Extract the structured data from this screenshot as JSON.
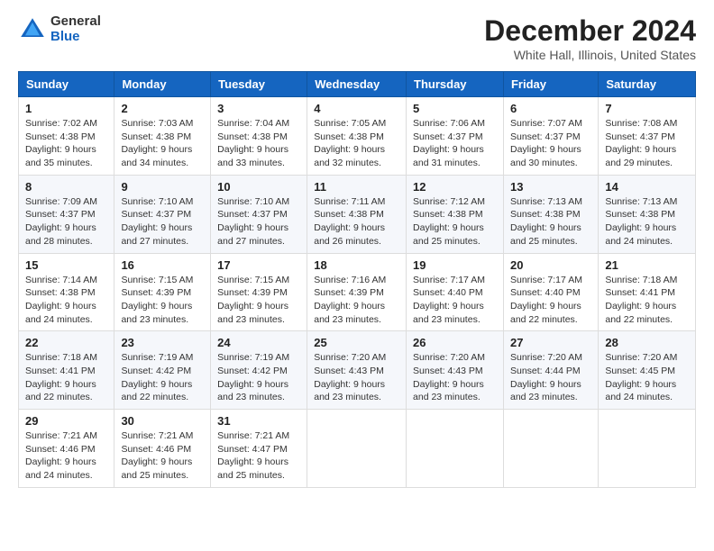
{
  "header": {
    "logo_general": "General",
    "logo_blue": "Blue",
    "title": "December 2024",
    "subtitle": "White Hall, Illinois, United States"
  },
  "days_of_week": [
    "Sunday",
    "Monday",
    "Tuesday",
    "Wednesday",
    "Thursday",
    "Friday",
    "Saturday"
  ],
  "weeks": [
    [
      {
        "day": "1",
        "info": "Sunrise: 7:02 AM\nSunset: 4:38 PM\nDaylight: 9 hours\nand 35 minutes."
      },
      {
        "day": "2",
        "info": "Sunrise: 7:03 AM\nSunset: 4:38 PM\nDaylight: 9 hours\nand 34 minutes."
      },
      {
        "day": "3",
        "info": "Sunrise: 7:04 AM\nSunset: 4:38 PM\nDaylight: 9 hours\nand 33 minutes."
      },
      {
        "day": "4",
        "info": "Sunrise: 7:05 AM\nSunset: 4:38 PM\nDaylight: 9 hours\nand 32 minutes."
      },
      {
        "day": "5",
        "info": "Sunrise: 7:06 AM\nSunset: 4:37 PM\nDaylight: 9 hours\nand 31 minutes."
      },
      {
        "day": "6",
        "info": "Sunrise: 7:07 AM\nSunset: 4:37 PM\nDaylight: 9 hours\nand 30 minutes."
      },
      {
        "day": "7",
        "info": "Sunrise: 7:08 AM\nSunset: 4:37 PM\nDaylight: 9 hours\nand 29 minutes."
      }
    ],
    [
      {
        "day": "8",
        "info": "Sunrise: 7:09 AM\nSunset: 4:37 PM\nDaylight: 9 hours\nand 28 minutes."
      },
      {
        "day": "9",
        "info": "Sunrise: 7:10 AM\nSunset: 4:37 PM\nDaylight: 9 hours\nand 27 minutes."
      },
      {
        "day": "10",
        "info": "Sunrise: 7:10 AM\nSunset: 4:37 PM\nDaylight: 9 hours\nand 27 minutes."
      },
      {
        "day": "11",
        "info": "Sunrise: 7:11 AM\nSunset: 4:38 PM\nDaylight: 9 hours\nand 26 minutes."
      },
      {
        "day": "12",
        "info": "Sunrise: 7:12 AM\nSunset: 4:38 PM\nDaylight: 9 hours\nand 25 minutes."
      },
      {
        "day": "13",
        "info": "Sunrise: 7:13 AM\nSunset: 4:38 PM\nDaylight: 9 hours\nand 25 minutes."
      },
      {
        "day": "14",
        "info": "Sunrise: 7:13 AM\nSunset: 4:38 PM\nDaylight: 9 hours\nand 24 minutes."
      }
    ],
    [
      {
        "day": "15",
        "info": "Sunrise: 7:14 AM\nSunset: 4:38 PM\nDaylight: 9 hours\nand 24 minutes."
      },
      {
        "day": "16",
        "info": "Sunrise: 7:15 AM\nSunset: 4:39 PM\nDaylight: 9 hours\nand 23 minutes."
      },
      {
        "day": "17",
        "info": "Sunrise: 7:15 AM\nSunset: 4:39 PM\nDaylight: 9 hours\nand 23 minutes."
      },
      {
        "day": "18",
        "info": "Sunrise: 7:16 AM\nSunset: 4:39 PM\nDaylight: 9 hours\nand 23 minutes."
      },
      {
        "day": "19",
        "info": "Sunrise: 7:17 AM\nSunset: 4:40 PM\nDaylight: 9 hours\nand 23 minutes."
      },
      {
        "day": "20",
        "info": "Sunrise: 7:17 AM\nSunset: 4:40 PM\nDaylight: 9 hours\nand 22 minutes."
      },
      {
        "day": "21",
        "info": "Sunrise: 7:18 AM\nSunset: 4:41 PM\nDaylight: 9 hours\nand 22 minutes."
      }
    ],
    [
      {
        "day": "22",
        "info": "Sunrise: 7:18 AM\nSunset: 4:41 PM\nDaylight: 9 hours\nand 22 minutes."
      },
      {
        "day": "23",
        "info": "Sunrise: 7:19 AM\nSunset: 4:42 PM\nDaylight: 9 hours\nand 22 minutes."
      },
      {
        "day": "24",
        "info": "Sunrise: 7:19 AM\nSunset: 4:42 PM\nDaylight: 9 hours\nand 23 minutes."
      },
      {
        "day": "25",
        "info": "Sunrise: 7:20 AM\nSunset: 4:43 PM\nDaylight: 9 hours\nand 23 minutes."
      },
      {
        "day": "26",
        "info": "Sunrise: 7:20 AM\nSunset: 4:43 PM\nDaylight: 9 hours\nand 23 minutes."
      },
      {
        "day": "27",
        "info": "Sunrise: 7:20 AM\nSunset: 4:44 PM\nDaylight: 9 hours\nand 23 minutes."
      },
      {
        "day": "28",
        "info": "Sunrise: 7:20 AM\nSunset: 4:45 PM\nDaylight: 9 hours\nand 24 minutes."
      }
    ],
    [
      {
        "day": "29",
        "info": "Sunrise: 7:21 AM\nSunset: 4:46 PM\nDaylight: 9 hours\nand 24 minutes."
      },
      {
        "day": "30",
        "info": "Sunrise: 7:21 AM\nSunset: 4:46 PM\nDaylight: 9 hours\nand 25 minutes."
      },
      {
        "day": "31",
        "info": "Sunrise: 7:21 AM\nSunset: 4:47 PM\nDaylight: 9 hours\nand 25 minutes."
      },
      null,
      null,
      null,
      null
    ]
  ]
}
